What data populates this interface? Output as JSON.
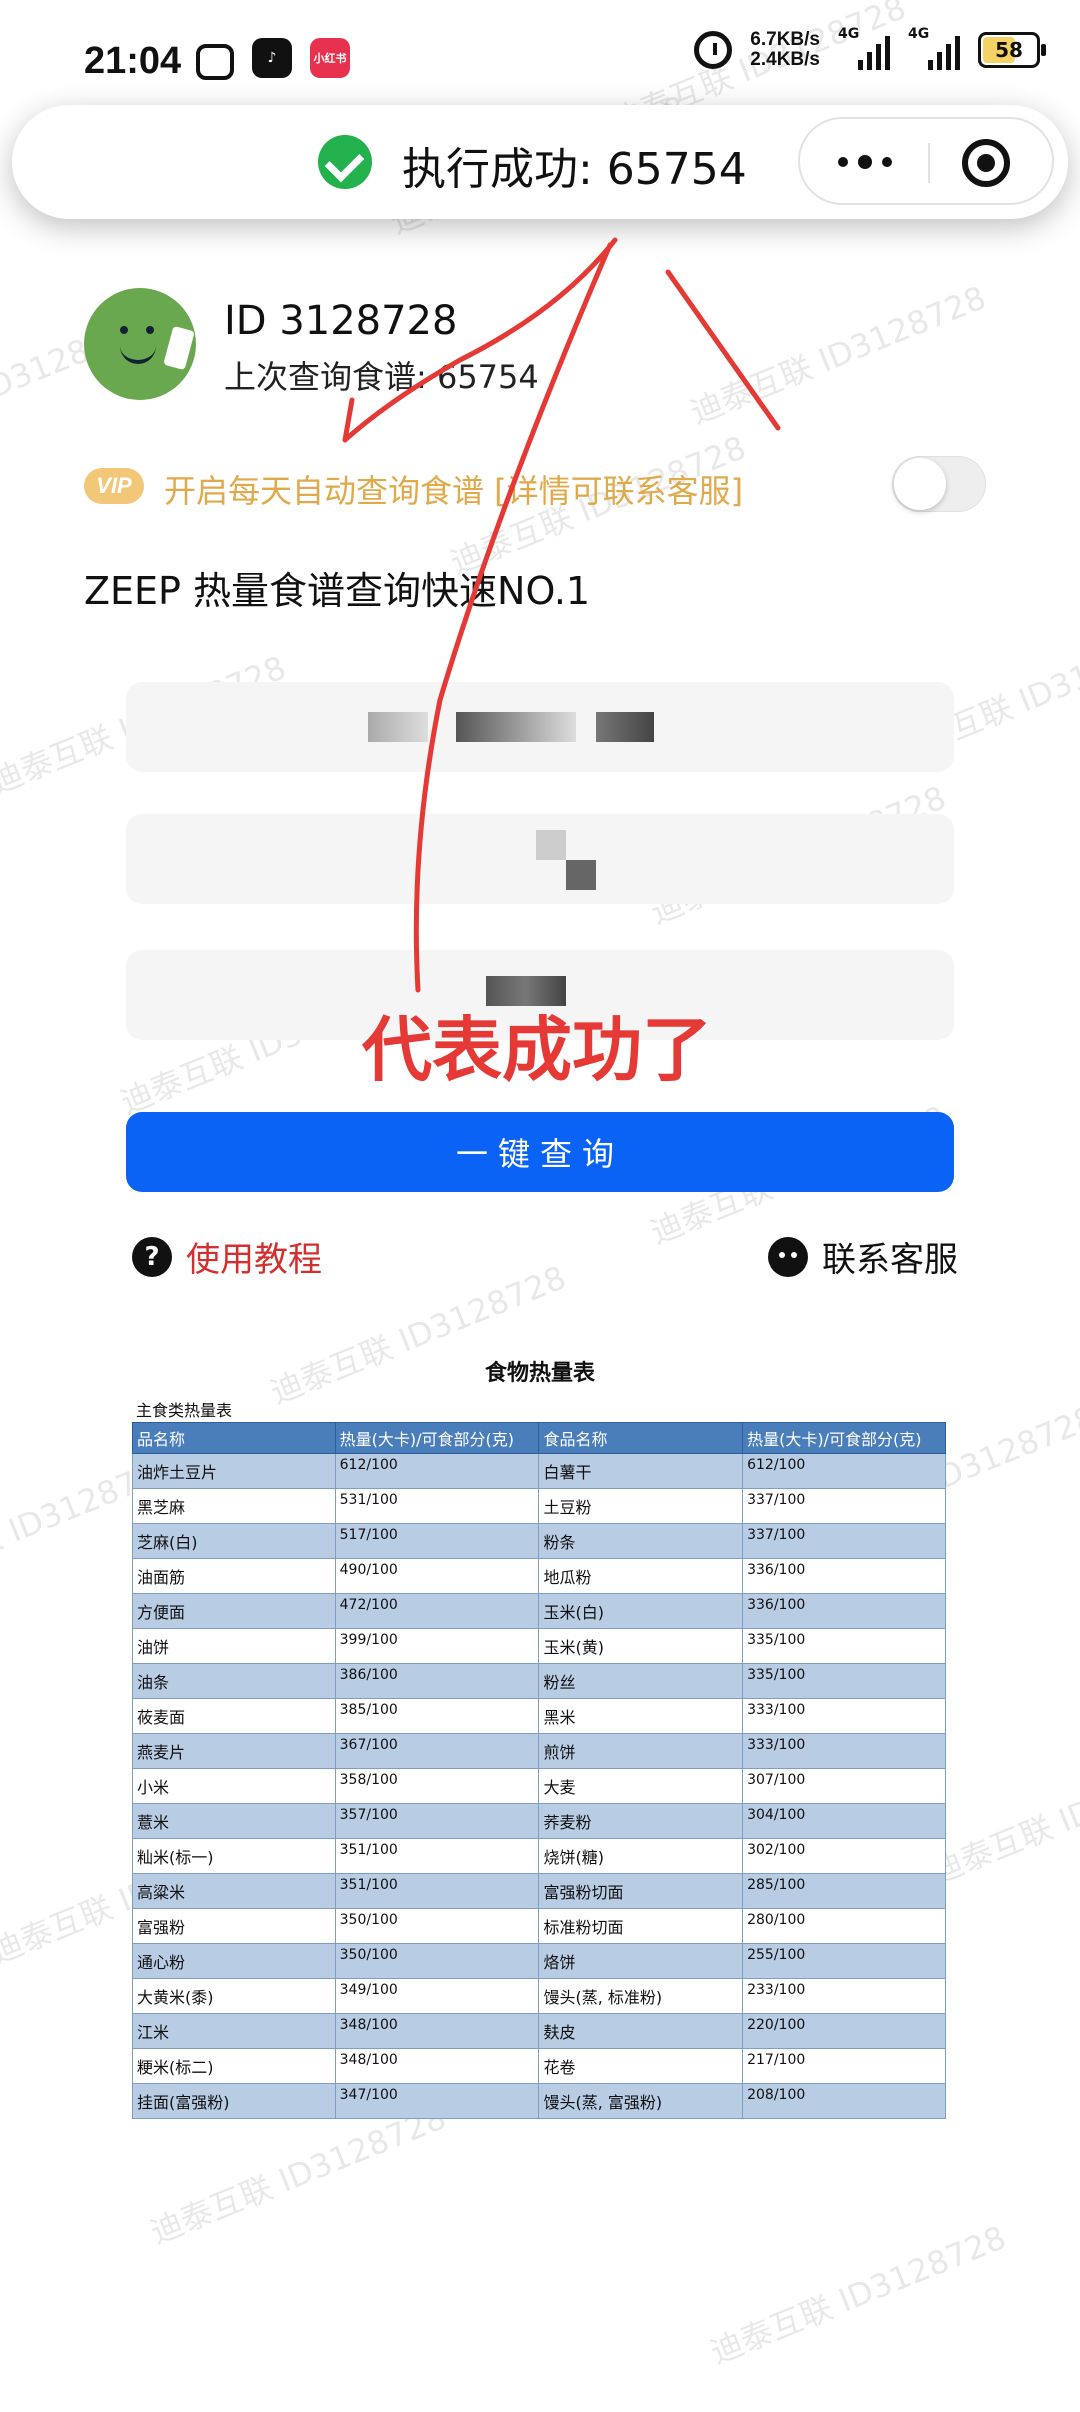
{
  "status_bar": {
    "time": "21:04",
    "app_icons": [
      "bilibili-icon",
      "tiktok-icon",
      "xiaohongshu-icon"
    ],
    "xiaohongshu_label": "小红书",
    "net_speed_up": "6.7KB/s",
    "net_speed_down": "2.4KB/s",
    "signal1_label": "4G",
    "signal2_label": "4G",
    "battery": "58",
    "battery_color": "#f4d265"
  },
  "toast": {
    "text": "执行成功: 65754",
    "icon": "check-circle-icon",
    "icon_color": "#22b14c"
  },
  "profile": {
    "id_label": "ID 3128728",
    "last_query": "上次查询食谱: 65754"
  },
  "vip": {
    "badge": "VIP",
    "text": "开启每天自动查询食谱 [详情可联系客服]",
    "text_color": "#e0a94a",
    "toggle_on": false
  },
  "heading": "ZEEP 热量食谱查询快速NO.1",
  "annotation": "代表成功了",
  "query_button": "一键查询",
  "query_button_color": "#0a63f5",
  "tutorial": "使用教程",
  "customer_service": "联系客服",
  "table": {
    "title": "食物热量表",
    "subtitle": "主食类热量表",
    "headers": [
      "品名称",
      "热量(大卡)/可食部分(克)",
      "食品名称",
      "热量(大卡)/可食部分(克)"
    ],
    "rows": [
      [
        "油炸土豆片",
        "612/100",
        "白薯干",
        "612/100"
      ],
      [
        "黑芝麻",
        "531/100",
        "土豆粉",
        "337/100"
      ],
      [
        "芝麻(白)",
        "517/100",
        "粉条",
        "337/100"
      ],
      [
        "油面筋",
        "490/100",
        "地瓜粉",
        "336/100"
      ],
      [
        "方便面",
        "472/100",
        "玉米(白)",
        "336/100"
      ],
      [
        "油饼",
        "399/100",
        "玉米(黄)",
        "335/100"
      ],
      [
        "油条",
        "386/100",
        "粉丝",
        "335/100"
      ],
      [
        "莜麦面",
        "385/100",
        "黑米",
        "333/100"
      ],
      [
        "燕麦片",
        "367/100",
        "煎饼",
        "333/100"
      ],
      [
        "小米",
        "358/100",
        "大麦",
        "307/100"
      ],
      [
        "薏米",
        "357/100",
        "荞麦粉",
        "304/100"
      ],
      [
        "籼米(标一)",
        "351/100",
        "烧饼(糖)",
        "302/100"
      ],
      [
        "高粱米",
        "351/100",
        "富强粉切面",
        "285/100"
      ],
      [
        "富强粉",
        "350/100",
        "标准粉切面",
        "280/100"
      ],
      [
        "通心粉",
        "350/100",
        "烙饼",
        "255/100"
      ],
      [
        "大黄米(黍)",
        "349/100",
        "馒头(蒸, 标准粉)",
        "233/100"
      ],
      [
        "江米",
        "348/100",
        "麸皮",
        "220/100"
      ],
      [
        "粳米(标二)",
        "348/100",
        "花卷",
        "217/100"
      ],
      [
        "挂面(富强粉)",
        "347/100",
        "馒头(蒸, 富强粉)",
        "208/100"
      ]
    ]
  },
  "watermark": "迪泰互联 ID3128728"
}
